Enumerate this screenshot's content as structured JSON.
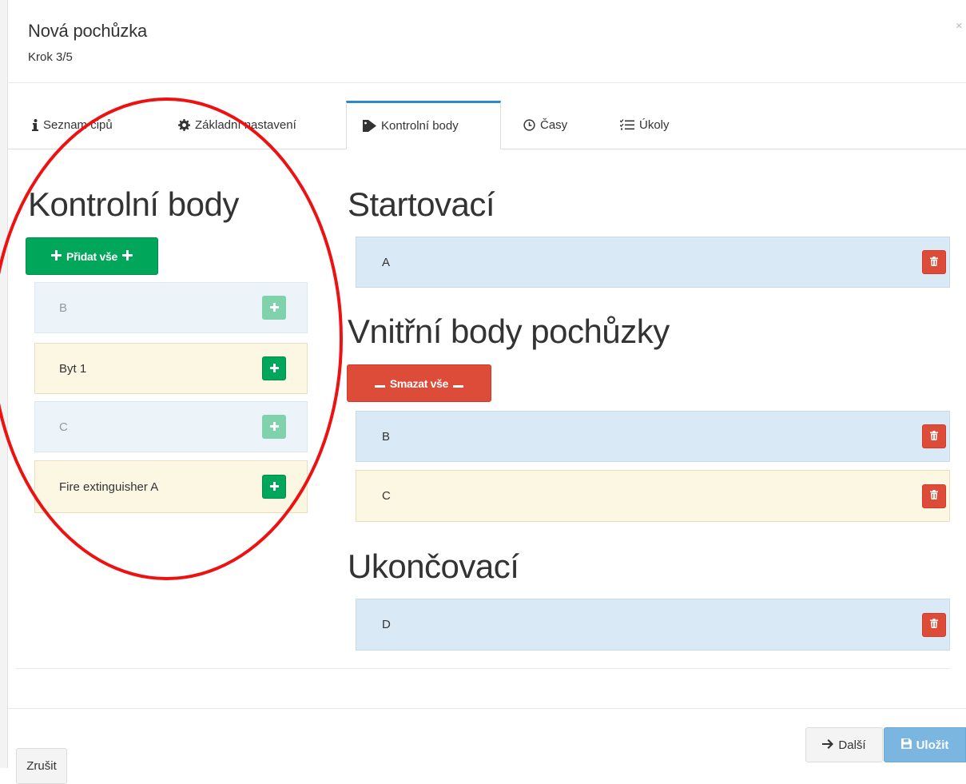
{
  "modal": {
    "title": "Nová pochůzka",
    "step": "Krok 3/5",
    "close": "×"
  },
  "tabs": [
    {
      "label": "Seznam čipů",
      "icon": "info-icon"
    },
    {
      "label": "Základní nastavení",
      "icon": "gear-icon"
    },
    {
      "label": "Kontrolní body",
      "icon": "tag-icon",
      "active": true
    },
    {
      "label": "Časy",
      "icon": "clock-icon"
    },
    {
      "label": "Úkoly",
      "icon": "list-icon"
    }
  ],
  "available": {
    "heading": "Kontrolní body",
    "add_all_label": "Přidat vše",
    "items": [
      {
        "label": "B",
        "state": "disabled"
      },
      {
        "label": "Byt 1",
        "state": "enabled"
      },
      {
        "label": "C",
        "state": "disabled"
      },
      {
        "label": "Fire extinguisher A",
        "state": "enabled"
      }
    ]
  },
  "route": {
    "start_heading": "Startovací",
    "start_items": [
      {
        "label": "A"
      }
    ],
    "inner_heading": "Vnitřní body pochůzky",
    "delete_all_label": "Smazat vše",
    "inner_items": [
      {
        "label": "B"
      },
      {
        "label": "C"
      }
    ],
    "end_heading": "Ukončovací",
    "end_items": [
      {
        "label": "D"
      }
    ]
  },
  "footer": {
    "cancel_label": "Zrušit",
    "next_label": "Další",
    "save_label": "Uložit"
  },
  "colors": {
    "green": "#00a65a",
    "red": "#dd4b39",
    "tab_accent": "#2a8bc9",
    "annotation": "#ee1111"
  }
}
